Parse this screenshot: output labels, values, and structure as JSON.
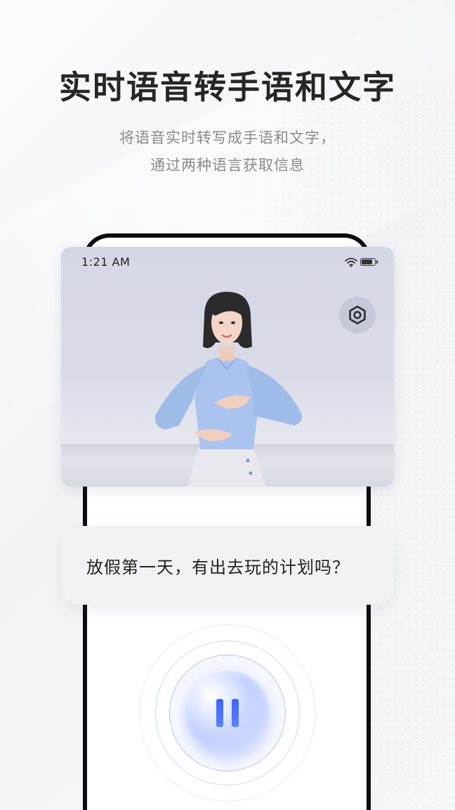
{
  "headline": "实时语音转手语和文字",
  "subtitle": {
    "line1": "将语音实时转写成手语和文字，",
    "line2": "通过两种语言获取信息"
  },
  "status_bar": {
    "time": "1:21 AM",
    "wifi_icon": "wifi-icon",
    "battery_icon": "battery-icon"
  },
  "video": {
    "settings_icon": "settings-icon",
    "avatar": "sign-language-avatar"
  },
  "caption": {
    "text": "放假第一天，有出去玩的计划吗？"
  },
  "control": {
    "icon": "pause-icon",
    "accent": "#3a64ff"
  }
}
